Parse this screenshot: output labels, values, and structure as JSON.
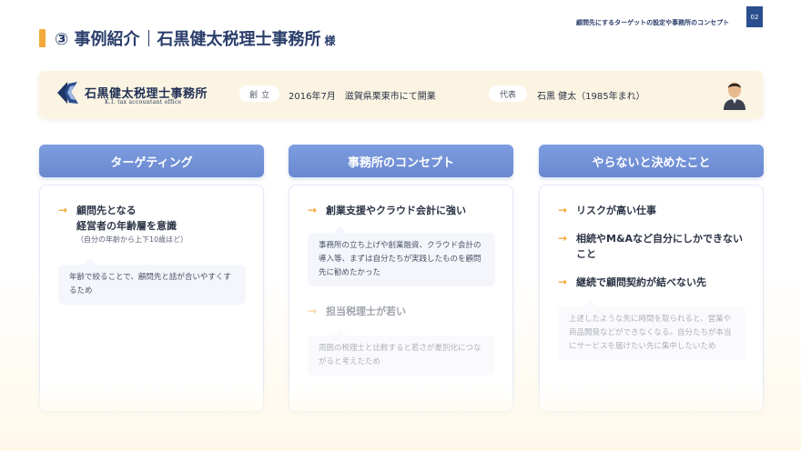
{
  "header": {
    "section_title": "③ 事例紹介",
    "company_title": "石黒健太税理士事務所",
    "suffix": "様",
    "topic": "顧問先にするターゲットの設定や事務所のコンセプト",
    "page_number": "02"
  },
  "profile": {
    "logo_name": "石黒健太税理士事務所",
    "logo_en": "K.I. tax accountant office",
    "founded_label": "創立",
    "founded_text": "2016年7月　滋賀県栗東市にて開業",
    "rep_label": "代表",
    "rep_text": "石黒 健太（1985年まれ）"
  },
  "columns": [
    {
      "heading": "ターゲティング",
      "items": [
        {
          "line1": "顧問先となる",
          "line2": "経営者の年齢層を意識",
          "sub": "（自分の年齢から上下10歳ほど）"
        }
      ],
      "note": "年齢で絞ることで、顧問先と話が合いやすくするため"
    },
    {
      "heading": "事務所のコンセプト",
      "items": [
        {
          "text": "創業支援やクラウド会計に強い"
        },
        {
          "text": "担当税理士が若い"
        }
      ],
      "notes": [
        "事務所の立ち上げや創業融資、クラウド会計の導入等、まずは自分たちが実践したものを顧問先に勧めたかった",
        "周囲の税理士と比較すると若さが差別化につながると考えたため"
      ]
    },
    {
      "heading": "やらないと決めたこと",
      "items": [
        {
          "text": "リスクが高い仕事"
        },
        {
          "text": "相続やM&Aなど自分にしかできないこと"
        },
        {
          "text": "継続で顧問契約が結べない先"
        }
      ],
      "note": "上述したような先に時間を取られると、営業や商品開発などができなくなる。自分たちが本当にサービスを届けたい先に集中したいため"
    }
  ],
  "icons": {
    "arrow": "→",
    "arrow_color": "#f3a93b",
    "accent_color": "#f3a93b",
    "header_blue": "#6f8fd6",
    "navy": "#2a3d6b"
  }
}
